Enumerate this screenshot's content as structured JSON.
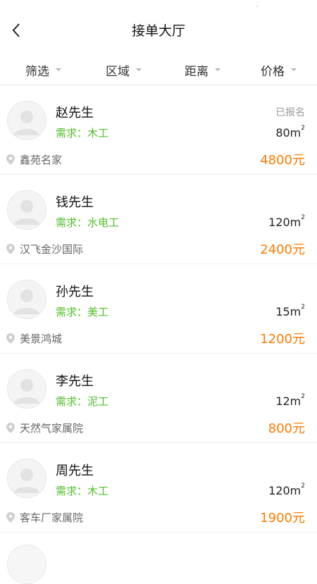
{
  "header": {
    "title": "接单大厅",
    "back_icon": "chevron-left-icon"
  },
  "filters": [
    {
      "label": "筛选"
    },
    {
      "label": "区域"
    },
    {
      "label": "距离"
    },
    {
      "label": "价格"
    }
  ],
  "orders": [
    {
      "name": "赵先生",
      "demand": "需求：木工",
      "badge": "已报名",
      "area_value": "80m",
      "area_unit": "2",
      "location": "鑫苑名家",
      "price": "4800元"
    },
    {
      "name": "钱先生",
      "demand": "需求：水电工",
      "badge": "",
      "area_value": "120m",
      "area_unit": "2",
      "location": "汉飞金沙国际",
      "price": "2400元"
    },
    {
      "name": "孙先生",
      "demand": "需求：美工",
      "badge": "",
      "area_value": "15m",
      "area_unit": "2",
      "location": "美景鸿城",
      "price": "1200元"
    },
    {
      "name": "李先生",
      "demand": "需求：泥工",
      "badge": "",
      "area_value": "12m",
      "area_unit": "2",
      "location": "天然气家属院",
      "price": "800元"
    },
    {
      "name": "周先生",
      "demand": "需求：木工",
      "badge": "",
      "area_value": "120m",
      "area_unit": "2",
      "location": "客车厂家属院",
      "price": "1900元"
    }
  ],
  "colors": {
    "demand_green": "#4fbf29",
    "price_orange": "#ff7a00",
    "muted_gray": "#999999"
  }
}
